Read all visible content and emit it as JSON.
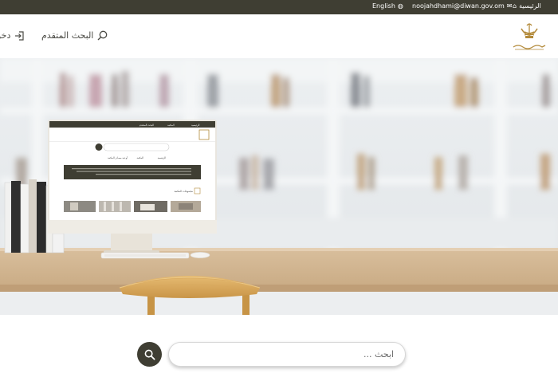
{
  "topbar": {
    "home_label": "الرئيسية",
    "email_label": "noojahdhami@diwan.gov.om",
    "language_label": "English"
  },
  "header": {
    "advanced_search_label": "البحث المتقدم",
    "login_label": "دخول"
  },
  "hero": {
    "screen_tabs": [
      "الرئيسية",
      "المكتبة",
      "البحث المتقدم"
    ],
    "screen_nav": [
      "الرئيسية",
      "المكتبة",
      "أوعية مصادر المكتبة"
    ],
    "screen_section_title": "مجموعات المكتبة"
  },
  "search": {
    "placeholder": "ابحث ..."
  },
  "colors": {
    "topbar_bg": "#3f3e33",
    "button_bg": "#3f3e33",
    "accent_gold": "#b38a3a"
  }
}
